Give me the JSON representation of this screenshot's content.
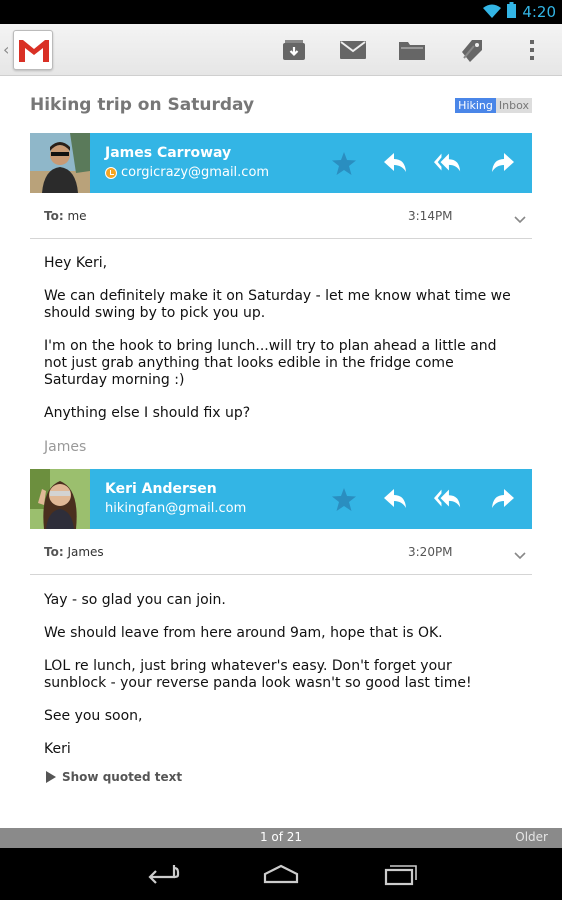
{
  "status": {
    "time": "4:20"
  },
  "actionbar": {
    "icons": [
      "archive-icon",
      "mark-unread-icon",
      "move-folder-icon",
      "label-icon",
      "overflow-menu-icon"
    ]
  },
  "conversation": {
    "subject": "Hiking trip on Saturday",
    "labels": [
      "Hiking",
      "Inbox"
    ]
  },
  "messages": [
    {
      "sender_name": "James Carroway",
      "sender_email": "corgicrazy@gmail.com",
      "to_label": "To:",
      "to": "me",
      "time": "3:14PM",
      "paragraphs": [
        "Hey Keri,",
        "We can definitely make it on Saturday - let me know what time we should swing by to pick you up.",
        "I'm on the hook to bring lunch...will try to plan ahead a little and not just grab anything that looks edible in the fridge come Saturday morning :)",
        "Anything else I should fix up?"
      ],
      "signature": "James"
    },
    {
      "sender_name": "Keri Andersen",
      "sender_email": "hikingfan@gmail.com",
      "to_label": "To:",
      "to": "James",
      "time": "3:20PM",
      "paragraphs": [
        "Yay - so glad you can join.",
        "We should leave from here around 9am, hope that is OK.",
        "LOL re lunch, just bring whatever's easy. Don't forget your sunblock - your reverse panda look wasn't so good last time!",
        "See you soon,",
        "Keri"
      ],
      "show_quoted": "Show quoted text"
    }
  ],
  "pager": {
    "count": "1 of 21",
    "older": "Older"
  },
  "colors": {
    "accent": "#33b5e5",
    "label_hiking": "#4a86e8"
  }
}
